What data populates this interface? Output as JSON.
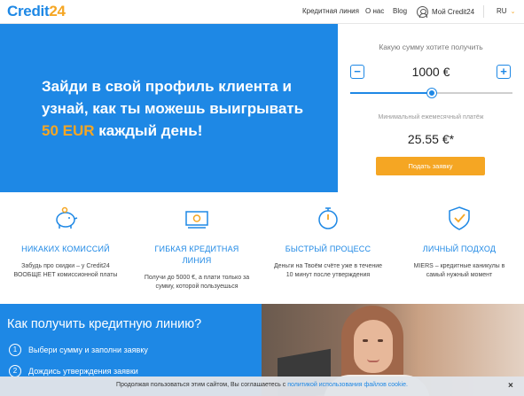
{
  "header": {
    "logo_part1": "Credit",
    "logo_part2": "24",
    "nav": [
      "Кредитная линия",
      "О нас",
      "Blog"
    ],
    "profile_label": "Мой Credit24",
    "language": "RU"
  },
  "hero": {
    "line1": "Зайди в свой профиль клиента и",
    "line2": "узнай, как ты можешь выигрывать",
    "accent": "50 EUR",
    "line3_rest": " каждый день!"
  },
  "calculator": {
    "title": "Какую сумму хотите получить",
    "minus": "−",
    "plus": "+",
    "amount": "1000 €",
    "slider_fraction": 0.5,
    "min_payment_label": "Минимальный ежемесячный платёж",
    "min_payment": "25.55 €*",
    "apply_button": "Подать заявку"
  },
  "features": [
    {
      "icon": "piggy-bank-icon",
      "title": "НИКАКИХ КОМИССИЙ",
      "desc1": "Забудь про скидки – у Credit24",
      "desc2": "ВООБЩЕ НЕТ комиссионной платы"
    },
    {
      "icon": "money-icon",
      "title1": "ГИБКАЯ КРЕДИТНАЯ",
      "title2": "ЛИНИЯ",
      "desc1": "Получи до 5000 €, а плати только за",
      "desc2": "сумму, которой пользуешься"
    },
    {
      "icon": "stopwatch-icon",
      "title": "БЫСТРЫЙ ПРОЦЕСС",
      "desc1": "Деньги на Твоём счёте уже в течение",
      "desc2": "10 минут после утверждения"
    },
    {
      "icon": "shield-check-icon",
      "title": "ЛИЧНЫЙ ПОДХОД",
      "desc1": "MIERS – кредитные каникулы в",
      "desc2": "самый нужный момент"
    }
  ],
  "how": {
    "title": "Как получить кредитную линию?",
    "steps": [
      {
        "num": "1",
        "text": "Выбери сумму и заполни заявку"
      },
      {
        "num": "2",
        "text": "Дождись утверждения заявки"
      }
    ]
  },
  "cookie": {
    "text": "Продолжая пользоваться этим сайтом, Вы соглашаетесь с ",
    "link": "политикой использования файлов cookie.",
    "close": "×"
  },
  "colors": {
    "brand_blue": "#1e88e5",
    "brand_orange": "#f5a623"
  }
}
